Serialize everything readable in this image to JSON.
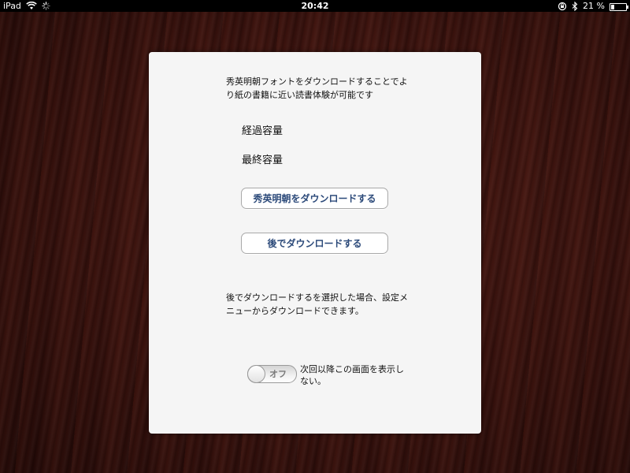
{
  "status_bar": {
    "device": "iPad",
    "time": "20:42",
    "battery": "21 %",
    "battery_level": 0.21
  },
  "dialog": {
    "intro_text": "秀英明朝フォントをダウンロードすることでより紙の書籍に近い読書体験が可能です",
    "elapsed_label": "経過容量",
    "final_label": "最終容量",
    "download_button": "秀英明朝をダウンロードする",
    "later_button": "後でダウンロードする",
    "note_text": "後でダウンロードするを選択した場合、設定メニューからダウンロードできます。",
    "toggle_state": "オフ",
    "toggle_label": "次回以降この画面を表示しない。"
  }
}
